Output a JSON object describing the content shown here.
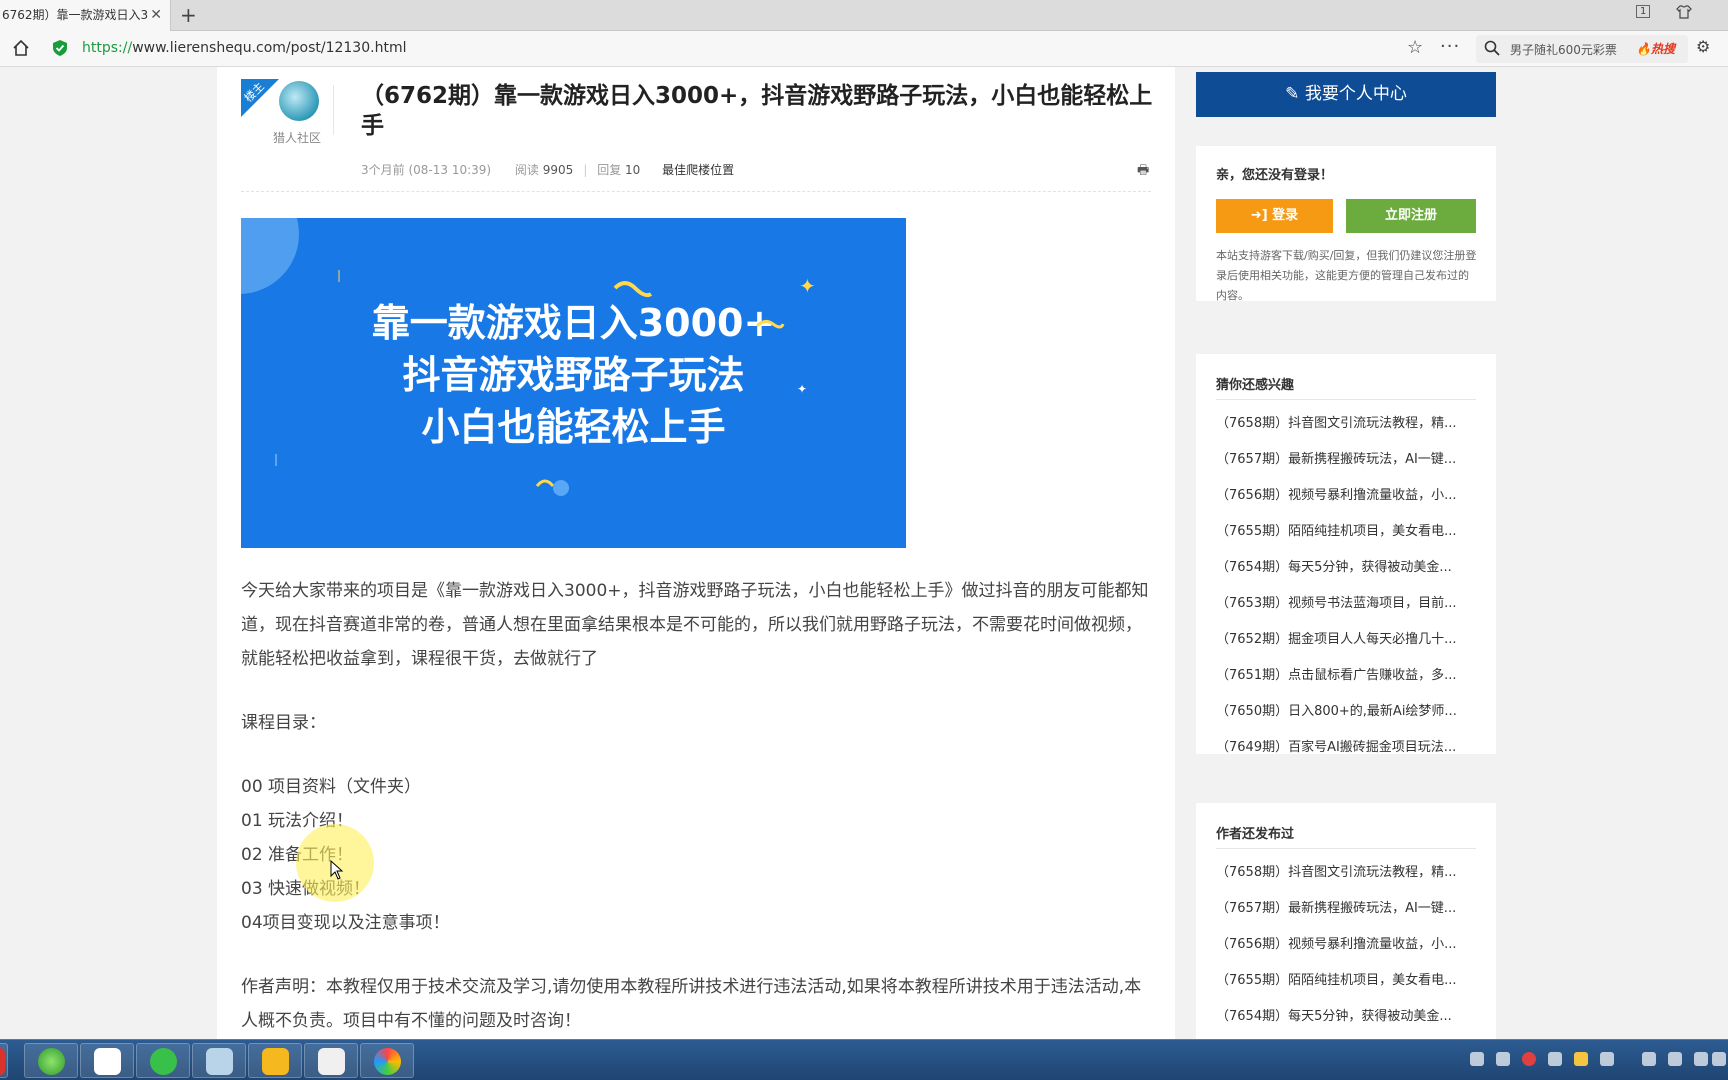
{
  "browser": {
    "tab_title": "6762期）靠一款游戏日入3",
    "tab_close": "✕",
    "new_tab": "+",
    "url_proto": "https://",
    "url_rest": "www.lierenshequ.com/post/12130.html",
    "search_text": "男子随礼600元彩票",
    "hot_badge": "热搜",
    "win_badge": "1"
  },
  "post": {
    "corner_label": "楼主",
    "author": "猎人社区",
    "title": "（6762期）靠一款游戏日入3000+，抖音游戏野路子玩法，小白也能轻松上手",
    "time": "3个月前 (08-13 10:39)",
    "read_label": "阅读",
    "read_count": "9905",
    "reply_label": "回复",
    "reply_count": "10",
    "best_floor": "最佳爬楼位置"
  },
  "banner": {
    "line1": "靠一款游戏日入3000+",
    "line2": "抖音游戏野路子玩法",
    "line3": "小白也能轻松上手",
    "bg_color": "#1778e6"
  },
  "article": {
    "intro": "今天给大家带来的项目是《靠一款游戏日入3000+，抖音游戏野路子玩法，小白也能轻松上手》做过抖音的朋友可能都知道，现在抖音赛道非常的卷，普通人想在里面拿结果根本是不可能的，所以我们就用野路子玩法，不需要花时间做视频，就能轻松把收益拿到，课程很干货，去做就行了",
    "toc_label": "课程目录：",
    "toc": [
      "00 项目资料（文件夹）",
      "01 玩法介绍！",
      "02 准备工作！",
      "03 快速做视频！",
      "04项目变现以及注意事项！"
    ],
    "disclaimer": "作者声明：本教程仅用于技术交流及学习,请勿使用本教程所讲技术进行违法活动,如果将本教程所讲技术用于违法活动,本人概不负责。项目中有不懂的问题及时咨询！"
  },
  "sidebar": {
    "center_button": "我要个人中心",
    "greet": "亲，您还没有登录！",
    "login": "登录",
    "register": "立即注册",
    "tip": "本站支持游客下载/购买/回复，但我们仍建议您注册登录后使用相关功能，这能更方便的管理自己发布过的内容。",
    "guess_title": "猜你还感兴趣",
    "guess": [
      "（7658期）抖音图文引流玩法教程，精...",
      "（7657期）最新携程搬砖玩法，AI一键...",
      "（7656期）视频号暴利撸流量收益，小...",
      "（7655期）陌陌纯挂机项目，美女看电...",
      "（7654期）每天5分钟，获得被动美金...",
      "（7653期）视频号书法蓝海项目，目前...",
      "（7652期）掘金项目人人每天必撸几十...",
      "（7651期）点击鼠标看广告赚收益，多...",
      "（7650期）日入800+的,最新Ai绘梦师...",
      "（7649期）百家号AI搬砖掘金项目玩法..."
    ],
    "author_title": "作者还发布过",
    "author_posts": [
      "（7658期）抖音图文引流玩法教程，精...",
      "（7657期）最新携程搬砖玩法，AI一键...",
      "（7656期）视频号暴利撸流量收益，小...",
      "（7655期）陌陌纯挂机项目，美女看电...",
      "（7654期）每天5分钟，获得被动美金..."
    ]
  },
  "icons": [
    "home-icon",
    "shield-icon",
    "star-icon",
    "more-icon",
    "search-icon",
    "print-icon",
    "edit-icon",
    "login-icon",
    "cursor-icon"
  ]
}
